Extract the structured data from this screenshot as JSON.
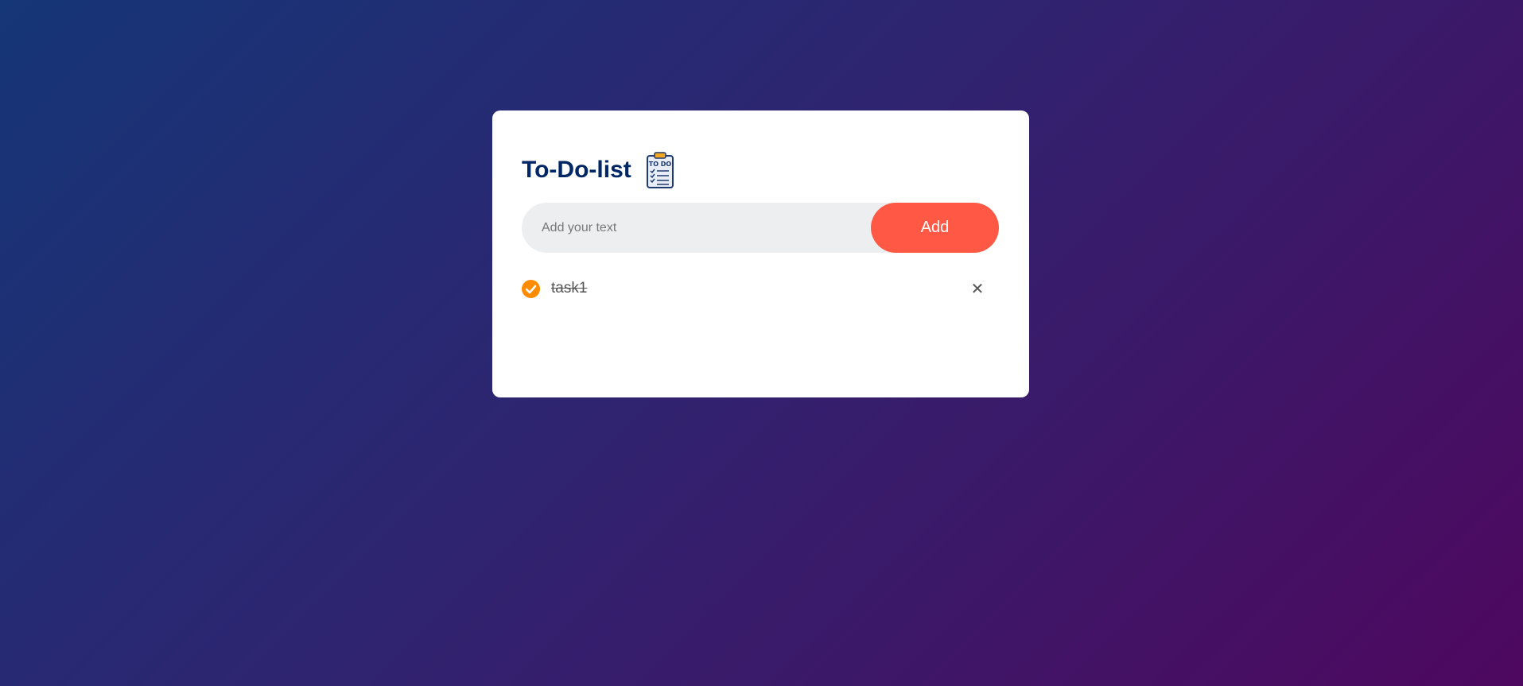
{
  "app": {
    "title": "To-Do-list",
    "icon": "clipboard-todo-icon"
  },
  "input": {
    "placeholder": "Add your text",
    "value": ""
  },
  "add_button": {
    "label": "Add",
    "color": "#ff5945"
  },
  "tasks": [
    {
      "text": "task1",
      "completed": true,
      "check_icon": "check-circle-icon",
      "delete_icon": "close-icon",
      "delete_symbol": "✕"
    }
  ],
  "colors": {
    "title": "#002765",
    "check": "#ff8c00",
    "background_start": "#153677",
    "background_end": "#4e085f"
  }
}
